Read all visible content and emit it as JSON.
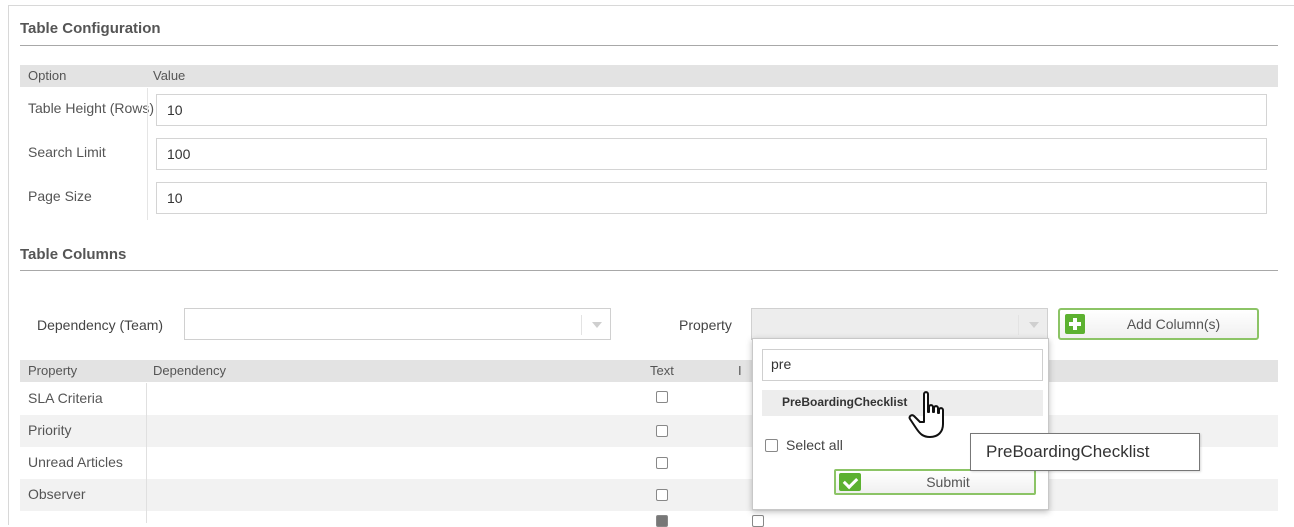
{
  "table_config": {
    "title": "Table Configuration",
    "headers": [
      "Option",
      "Value"
    ],
    "rows": [
      {
        "label": "Table Height (Rows)",
        "value": "10"
      },
      {
        "label": "Search Limit",
        "value": "100"
      },
      {
        "label": "Page Size",
        "value": "10"
      }
    ]
  },
  "table_columns": {
    "title": "Table Columns",
    "dependency_label": "Dependency (Team)",
    "dependency_value": "",
    "property_label": "Property",
    "property_value": "",
    "add_button_label": "Add Column(s)",
    "headers": [
      "Property",
      "Dependency",
      "Text",
      "I"
    ],
    "rows": [
      {
        "property": "SLA Criteria",
        "dependency": "",
        "text_checked": false
      },
      {
        "property": "Priority",
        "dependency": "",
        "text_checked": false
      },
      {
        "property": "Unread Articles",
        "dependency": "",
        "text_checked": false
      },
      {
        "property": "Observer",
        "dependency": "",
        "text_checked": false
      }
    ]
  },
  "property_dropdown": {
    "search_value": "pre",
    "options": [
      "PreBoardingChecklist"
    ],
    "select_all_label": "Select all",
    "submit_label": "Submit"
  },
  "tooltip": {
    "text": "PreBoardingChecklist"
  },
  "colors": {
    "accent_green": "#5cb130",
    "button_border": "#8cc466",
    "header_bg": "#e3e3e3"
  }
}
